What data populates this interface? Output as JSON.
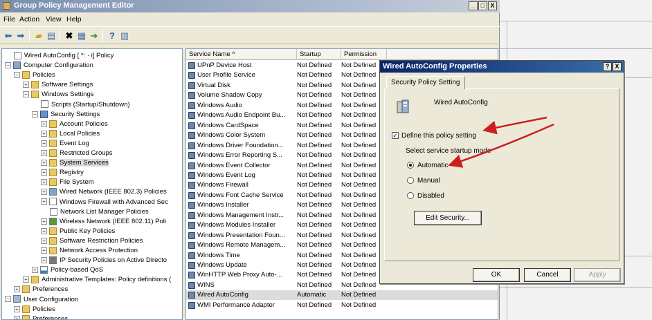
{
  "window": {
    "title": "Group Policy Management Editor",
    "buttons": [
      "_",
      "□",
      "X"
    ]
  },
  "menu": [
    "File",
    "Action",
    "View",
    "Help"
  ],
  "toolbar": {
    "icons": [
      "back-arrow-icon",
      "forward-arrow-icon",
      "up-folder-icon",
      "show-hide-tree-icon",
      "delete-icon",
      "properties-icon",
      "export-icon",
      "help-icon",
      "console-icon"
    ]
  },
  "tree": [
    {
      "label": "Wired AutoConfig [ *: ·                    i] Policy",
      "depth": 0,
      "expander": "",
      "icon": "doc"
    },
    {
      "label": "Computer Configuration",
      "depth": 0,
      "expander": "−",
      "icon": "computer"
    },
    {
      "label": "Policies",
      "depth": 1,
      "expander": "−",
      "icon": "folder"
    },
    {
      "label": "Software Settings",
      "depth": 2,
      "expander": "+",
      "icon": "folder"
    },
    {
      "label": "Windows Settings",
      "depth": 2,
      "expander": "−",
      "icon": "folder"
    },
    {
      "label": "Scripts (Startup/Shutdown)",
      "depth": 3,
      "expander": "",
      "icon": "doc"
    },
    {
      "label": "Security Settings",
      "depth": 3,
      "expander": "−",
      "icon": "shield"
    },
    {
      "label": "Account Policies",
      "depth": 4,
      "expander": "+",
      "icon": "folder"
    },
    {
      "label": "Local Policies",
      "depth": 4,
      "expander": "+",
      "icon": "folder"
    },
    {
      "label": "Event Log",
      "depth": 4,
      "expander": "+",
      "icon": "folder"
    },
    {
      "label": "Restricted Groups",
      "depth": 4,
      "expander": "+",
      "icon": "folder"
    },
    {
      "label": "System Services",
      "depth": 4,
      "expander": "+",
      "icon": "folder",
      "selected": true
    },
    {
      "label": "Registry",
      "depth": 4,
      "expander": "+",
      "icon": "folder"
    },
    {
      "label": "File System",
      "depth": 4,
      "expander": "+",
      "icon": "folder"
    },
    {
      "label": "Wired Network (IEEE 802.3) Policies",
      "depth": 4,
      "expander": "+",
      "icon": "net"
    },
    {
      "label": "Windows Firewall with Advanced Sec",
      "depth": 4,
      "expander": "+",
      "icon": "doc"
    },
    {
      "label": "Network List Manager Policies",
      "depth": 4,
      "expander": "",
      "icon": "doc"
    },
    {
      "label": "Wireless Network (IEEE 802.11) Poli",
      "depth": 4,
      "expander": "+",
      "icon": "wifi"
    },
    {
      "label": "Public Key Policies",
      "depth": 4,
      "expander": "+",
      "icon": "folder"
    },
    {
      "label": "Software Restriction Policies",
      "depth": 4,
      "expander": "+",
      "icon": "folder"
    },
    {
      "label": "Network Access Protection",
      "depth": 4,
      "expander": "+",
      "icon": "folder"
    },
    {
      "label": "IP Security Policies on Active Directo",
      "depth": 4,
      "expander": "+",
      "icon": "lock"
    },
    {
      "label": "Policy-based QoS",
      "depth": 3,
      "expander": "+",
      "icon": "chart"
    },
    {
      "label": "Administrative Templates: Policy definitions (",
      "depth": 2,
      "expander": "+",
      "icon": "folder"
    },
    {
      "label": "Preferences",
      "depth": 1,
      "expander": "+",
      "icon": "folder"
    },
    {
      "label": "User Configuration",
      "depth": 0,
      "expander": "−",
      "icon": "user"
    },
    {
      "label": "Policies",
      "depth": 1,
      "expander": "+",
      "icon": "folder"
    },
    {
      "label": "Preferences",
      "depth": 1,
      "expander": "+",
      "icon": "folder"
    }
  ],
  "list": {
    "columns": [
      "Service Name  ^",
      "Startup",
      "Permission"
    ],
    "rows": [
      {
        "name": "UPnP Device Host",
        "startup": "Not Defined",
        "permission": "Not Defined"
      },
      {
        "name": "User Profile Service",
        "startup": "Not Defined",
        "permission": "Not Defined"
      },
      {
        "name": "Virtual Disk",
        "startup": "Not Defined",
        "permission": "Not Defined"
      },
      {
        "name": "Volume Shadow Copy",
        "startup": "Not Defined",
        "permission": "Not Defined"
      },
      {
        "name": "Windows Audio",
        "startup": "Not Defined",
        "permission": "Not Defined"
      },
      {
        "name": "Windows Audio Endpoint Bu...",
        "startup": "Not Defined",
        "permission": "Not Defined"
      },
      {
        "name": "Windows CardSpace",
        "startup": "Not Defined",
        "permission": "Not Defined"
      },
      {
        "name": "Windows Color System",
        "startup": "Not Defined",
        "permission": "Not Defined"
      },
      {
        "name": "Windows Driver Foundation...",
        "startup": "Not Defined",
        "permission": "Not Defined"
      },
      {
        "name": "Windows Error Reporting S...",
        "startup": "Not Defined",
        "permission": "Not Defined"
      },
      {
        "name": "Windows Event Collector",
        "startup": "Not Defined",
        "permission": "Not Defined"
      },
      {
        "name": "Windows Event Log",
        "startup": "Not Defined",
        "permission": "Not Defined"
      },
      {
        "name": "Windows Firewall",
        "startup": "Not Defined",
        "permission": "Not Defined"
      },
      {
        "name": "Windows Font Cache Service",
        "startup": "Not Defined",
        "permission": "Not Defined"
      },
      {
        "name": "Windows Installer",
        "startup": "Not Defined",
        "permission": "Not Defined"
      },
      {
        "name": "Windows Management Instr...",
        "startup": "Not Defined",
        "permission": "Not Defined"
      },
      {
        "name": "Windows Modules Installer",
        "startup": "Not Defined",
        "permission": "Not Defined"
      },
      {
        "name": "Windows Presentation Foun...",
        "startup": "Not Defined",
        "permission": "Not Defined"
      },
      {
        "name": "Windows Remote Managem...",
        "startup": "Not Defined",
        "permission": "Not Defined"
      },
      {
        "name": "Windows Time",
        "startup": "Not Defined",
        "permission": "Not Defined"
      },
      {
        "name": "Windows Update",
        "startup": "Not Defined",
        "permission": "Not Defined"
      },
      {
        "name": "WinHTTP Web Proxy Auto-...",
        "startup": "Not Defined",
        "permission": "Not Defined"
      },
      {
        "name": "WINS",
        "startup": "Not Defined",
        "permission": "Not Defined"
      },
      {
        "name": "Wired AutoConfig",
        "startup": "Automatic",
        "permission": "Not Defined",
        "selected": true
      },
      {
        "name": "WMI Performance Adapter",
        "startup": "Not Defined",
        "permission": "Not Defined"
      }
    ]
  },
  "dialog": {
    "title": "Wired AutoConfig Properties",
    "title_buttons": [
      "?",
      "X"
    ],
    "tab": "Security Policy Setting",
    "service_name": "Wired AutoConfig",
    "define_label": "Define this policy setting",
    "define_checked": true,
    "startup_label": "Select service startup mode",
    "radios": [
      {
        "label": "Automatic",
        "checked": true
      },
      {
        "label": "Manual",
        "checked": false
      },
      {
        "label": "Disabled",
        "checked": false
      }
    ],
    "edit_security": "Edit Security...",
    "ok": "OK",
    "cancel": "Cancel",
    "apply": "Apply"
  },
  "colors": {
    "annotation_arrow": "#cc1f1f",
    "dialog_titlebar": "#0a246a"
  }
}
